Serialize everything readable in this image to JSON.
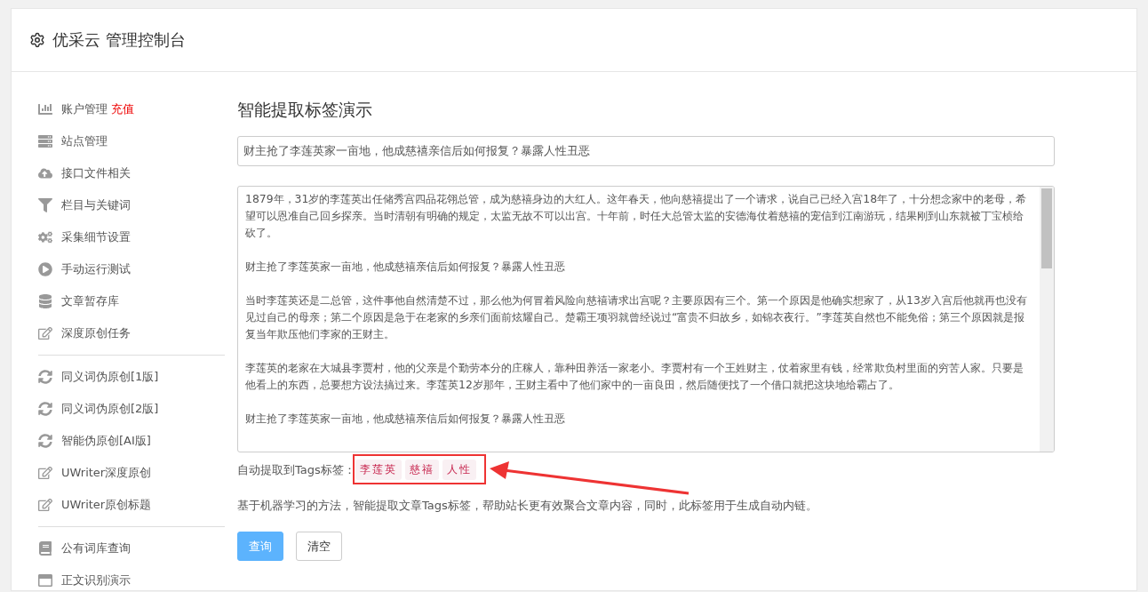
{
  "header": {
    "title": "优采云 管理控制台"
  },
  "sidebar": {
    "groups": [
      {
        "items": [
          {
            "label": "账户管理",
            "badge": "充值"
          },
          {
            "label": "站点管理"
          },
          {
            "label": "接口文件相关"
          },
          {
            "label": "栏目与关键词"
          },
          {
            "label": "采集细节设置"
          },
          {
            "label": "手动运行测试"
          },
          {
            "label": "文章暂存库"
          },
          {
            "label": "深度原创任务"
          }
        ]
      },
      {
        "items": [
          {
            "label": "同义词伪原创[1版]"
          },
          {
            "label": "同义词伪原创[2版]"
          },
          {
            "label": "智能伪原创[AI版]"
          },
          {
            "label": "UWriter深度原创"
          },
          {
            "label": "UWriter原创标题"
          }
        ]
      },
      {
        "items": [
          {
            "label": "公有词库查询"
          },
          {
            "label": "正文识别演示"
          }
        ]
      }
    ]
  },
  "main": {
    "heading": "智能提取标签演示",
    "title_field": {
      "value": "财主抢了李莲英家一亩地，他成慈禧亲信后如何报复？暴露人性丑恶"
    },
    "content_field": {
      "paragraphs": [
        "1879年，31岁的李莲英出任储秀宫四品花翎总管，成为慈禧身边的大红人。这年春天，他向慈禧提出了一个请求，说自己已经入宫18年了，十分想念家中的老母，希望可以恩准自己回乡探亲。当时清朝有明确的规定，太监无故不可以出宫。十年前，时任大总管太监的安德海仗着慈禧的宠信到江南游玩，结果刚到山东就被丁宝桢给砍了。",
        "财主抢了李莲英家一亩地，他成慈禧亲信后如何报复？暴露人性丑恶",
        "当时李莲英还是二总管，这件事他自然清楚不过，那么他为何冒着风险向慈禧请求出宫呢？主要原因有三个。第一个原因是他确实想家了，从13岁入宫后他就再也没有见过自己的母亲；第二个原因是急于在老家的乡亲们面前炫耀自己。楚霸王项羽就曾经说过“富贵不归故乡，如锦衣夜行。”李莲英自然也不能免俗；第三个原因就是报复当年欺压他们李家的王财主。",
        "李莲英的老家在大城县李贾村，他的父亲是个勤劳本分的庄稼人，靠种田养活一家老小。李贾村有一个王姓财主，仗着家里有钱，经常欺负村里面的穷苦人家。只要是他看上的东西，总要想方设法搞过来。李莲英12岁那年，王财主看中了他们家中的一亩良田，然后随便找了一个借口就把这块地给霸占了。",
        "财主抢了李莲英家一亩地，他成慈禧亲信后如何报复？暴露人性丑恶"
      ]
    },
    "tags_label": "自动提取到Tags标签：",
    "tags": [
      "李莲英",
      "慈禧",
      "人性"
    ],
    "description": "基于机器学习的方法，智能提取文章Tags标签，帮助站长更有效聚合文章内容，同时，此标签用于生成自动内链。",
    "buttons": [
      {
        "label": "查询",
        "kind": "primary"
      },
      {
        "label": "清空",
        "kind": "default"
      }
    ]
  }
}
